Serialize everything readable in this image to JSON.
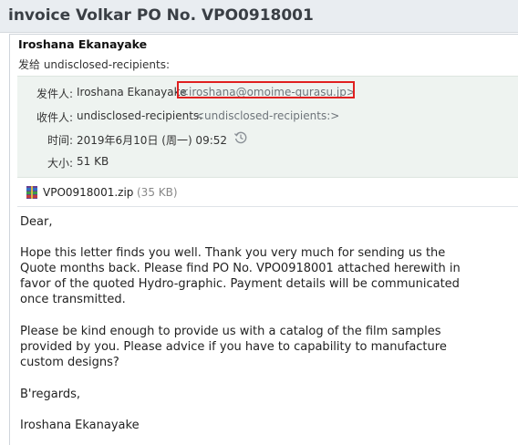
{
  "window": {
    "subject": "invoice Volkar PO No. VPO0918001"
  },
  "message": {
    "sender_name": "Iroshana Ekanayake",
    "to_summary": "发给 undisclosed-recipients:",
    "headers": {
      "from_label": "发件人:",
      "from_name": "Iroshana Ekanayake",
      "from_email": "<iroshana@omoime-gurasu.jp>",
      "to_label": "收件人:",
      "to_name": "undisclosed-recipients:",
      "to_email": "<undisclosed-recipients:>",
      "time_label": "时间:",
      "time_value": "2019年6月10日 (周一) 09:52",
      "size_label": "大小:",
      "size_value": "51 KB"
    },
    "attachment": {
      "name": "VPO0918001.zip",
      "size": "(35 KB)"
    },
    "body": {
      "greeting": "Dear,",
      "p1_l1": "Hope this letter finds you well. Thank you very much for sending us the",
      "p1_l2": "Quote months back. Please find PO No. VPO0918001 attached herewith in",
      "p1_l3": "favor of the quoted Hydro-graphic. Payment details will be communicated",
      "p1_l4": "once transmitted.",
      "p2_l1": "Please be kind enough to provide us with a catalog of the film samples",
      "p2_l2": "provided by you. Please advice if you have to capability to manufacture",
      "p2_l3": "custom designs?",
      "closing": "B'regards,",
      "signature": "Iroshana Ekanayake"
    }
  },
  "colors": {
    "title_bar": "#e9edf1",
    "header_box": "#eef3f0",
    "highlight": "#e02020"
  }
}
